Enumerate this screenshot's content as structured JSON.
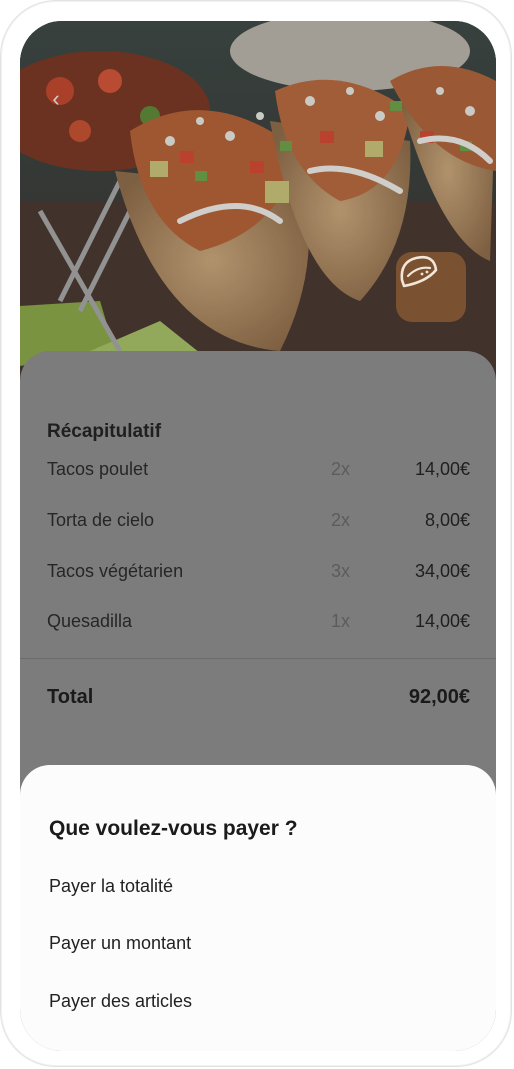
{
  "hero": {
    "back_icon": "chevron-left-icon",
    "badge_icon": "taco-icon",
    "badge_color": "#7a5232"
  },
  "summary": {
    "title": "Récapitulatif",
    "items": [
      {
        "name": "Tacos poulet",
        "qty": "2x",
        "price": "14,00€"
      },
      {
        "name": "Torta de cielo",
        "qty": "2x",
        "price": "8,00€"
      },
      {
        "name": "Tacos végétarien",
        "qty": "3x",
        "price": "34,00€"
      },
      {
        "name": "Quesadilla",
        "qty": "1x",
        "price": "14,00€"
      }
    ],
    "total_label": "Total",
    "total_value": "92,00€"
  },
  "payment": {
    "title": "Que voulez-vous payer ?",
    "options": [
      "Payer la totalité",
      "Payer un montant",
      "Payer des articles"
    ]
  }
}
